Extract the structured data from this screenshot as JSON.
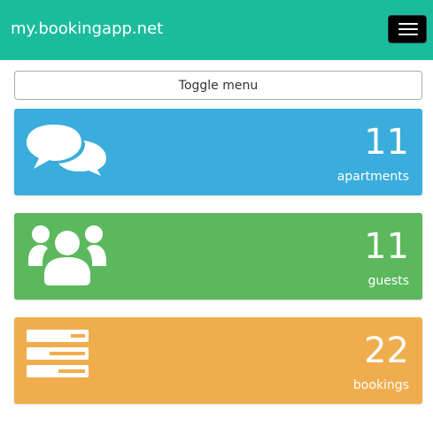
{
  "navbar": {
    "brand": "my.bookingapp.net",
    "menu_icon": "hamburger-icon",
    "color": "#1abc9c"
  },
  "toggle_button": {
    "label": "Toggle menu"
  },
  "cards": [
    {
      "count": "11",
      "label": "apartments",
      "icon": "comments-icon",
      "color": "#3aaddc"
    },
    {
      "count": "11",
      "label": "guests",
      "icon": "users-icon",
      "color": "#5cb85c"
    },
    {
      "count": "22",
      "label": "bookings",
      "icon": "server-list-icon",
      "color": "#f0ad4e"
    }
  ]
}
